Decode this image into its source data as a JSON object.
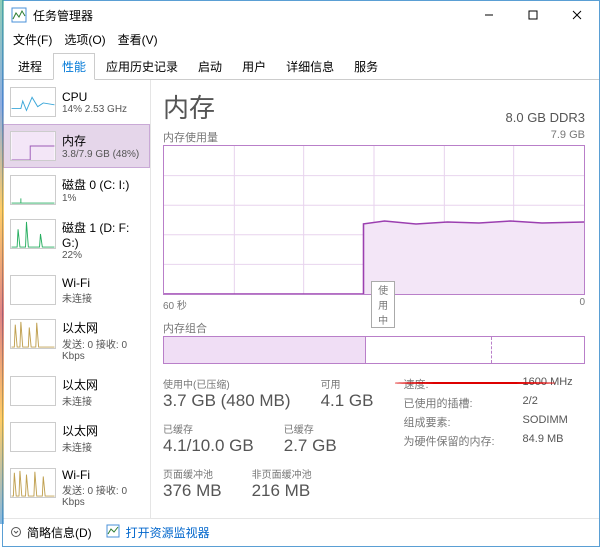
{
  "window": {
    "title": "任务管理器"
  },
  "menu": {
    "file": "文件(F)",
    "options": "选项(O)",
    "view": "查看(V)"
  },
  "tabs": {
    "items": [
      "进程",
      "性能",
      "应用历史记录",
      "启动",
      "用户",
      "详细信息",
      "服务"
    ],
    "active": 1
  },
  "sidebar": {
    "items": [
      {
        "name": "CPU",
        "sub": "14% 2.53 GHz",
        "color": "#3ba7d9",
        "type": "cpu"
      },
      {
        "name": "内存",
        "sub": "3.8/7.9 GB (48%)",
        "color": "#9b59b6",
        "type": "mem"
      },
      {
        "name": "磁盘 0 (C: I:)",
        "sub": "1%",
        "color": "#27ae60",
        "type": "disk"
      },
      {
        "name": "磁盘 1 (D: F: G:)",
        "sub": "22%",
        "color": "#27ae60",
        "type": "disk2"
      },
      {
        "name": "Wi-Fi",
        "sub": "未连接",
        "color": "#c0a050",
        "type": "flat"
      },
      {
        "name": "以太网",
        "sub": "发送: 0 接收: 0 Kbps",
        "color": "#c0a050",
        "type": "eth"
      },
      {
        "name": "以太网",
        "sub": "未连接",
        "color": "#c0a050",
        "type": "flat"
      },
      {
        "name": "以太网",
        "sub": "未连接",
        "color": "#c0a050",
        "type": "flat"
      },
      {
        "name": "Wi-Fi",
        "sub": "发送: 0 接收: 0 Kbps",
        "color": "#c0a050",
        "type": "eth"
      }
    ],
    "selected": 1
  },
  "main": {
    "title": "内存",
    "spec": "8.0 GB DDR3",
    "usage_label": "内存使用量",
    "usage_max": "7.9 GB",
    "x_left": "60 秒",
    "x_mid": "使用中",
    "x_right": "0",
    "comp_label": "内存组合"
  },
  "chart_data": {
    "type": "area",
    "title": "内存使用量",
    "ylabel": "GB",
    "ylim": [
      0,
      7.9
    ],
    "x_seconds": [
      60,
      55,
      50,
      45,
      40,
      35,
      30,
      25,
      20,
      15,
      10,
      5,
      0
    ],
    "values": [
      0,
      0,
      0,
      0,
      0,
      0,
      3.75,
      3.78,
      3.8,
      3.78,
      3.82,
      3.8,
      3.8
    ]
  },
  "composition": {
    "segments": [
      {
        "name": "in_use",
        "fraction": 0.48,
        "fill": "#e9d5ef",
        "border": "#b97fc9"
      },
      {
        "name": "standby",
        "fraction": 0.3,
        "fill": "#ffffff",
        "border": "#b97fc9"
      },
      {
        "name": "free",
        "fraction": 0.22,
        "fill": "#ffffff",
        "border": "#b97fc9"
      }
    ]
  },
  "stats": {
    "used_label": "使用中(已压缩)",
    "used_value": "3.7 GB (480 MB)",
    "avail_label": "可用",
    "avail_value": "4.1 GB",
    "commit_label": "已缓存",
    "commit_value": "4.1/10.0 GB",
    "cache_label": "已缓存",
    "cache_value": "2.7 GB",
    "paged_label": "页面缓冲池",
    "paged_value": "376 MB",
    "nonpaged_label": "非页面缓冲池",
    "nonpaged_value": "216 MB"
  },
  "stats_right": {
    "speed_label": "速度:",
    "speed_value": "1600 MHz",
    "slots_label": "已使用的插槽:",
    "slots_value": "2/2",
    "form_label": "组成要素:",
    "form_value": "SODIMM",
    "hw_label": "为硬件保留的内存:",
    "hw_value": "84.9 MB"
  },
  "footer": {
    "less": "简略信息(D)",
    "link": "打开资源监视器"
  }
}
